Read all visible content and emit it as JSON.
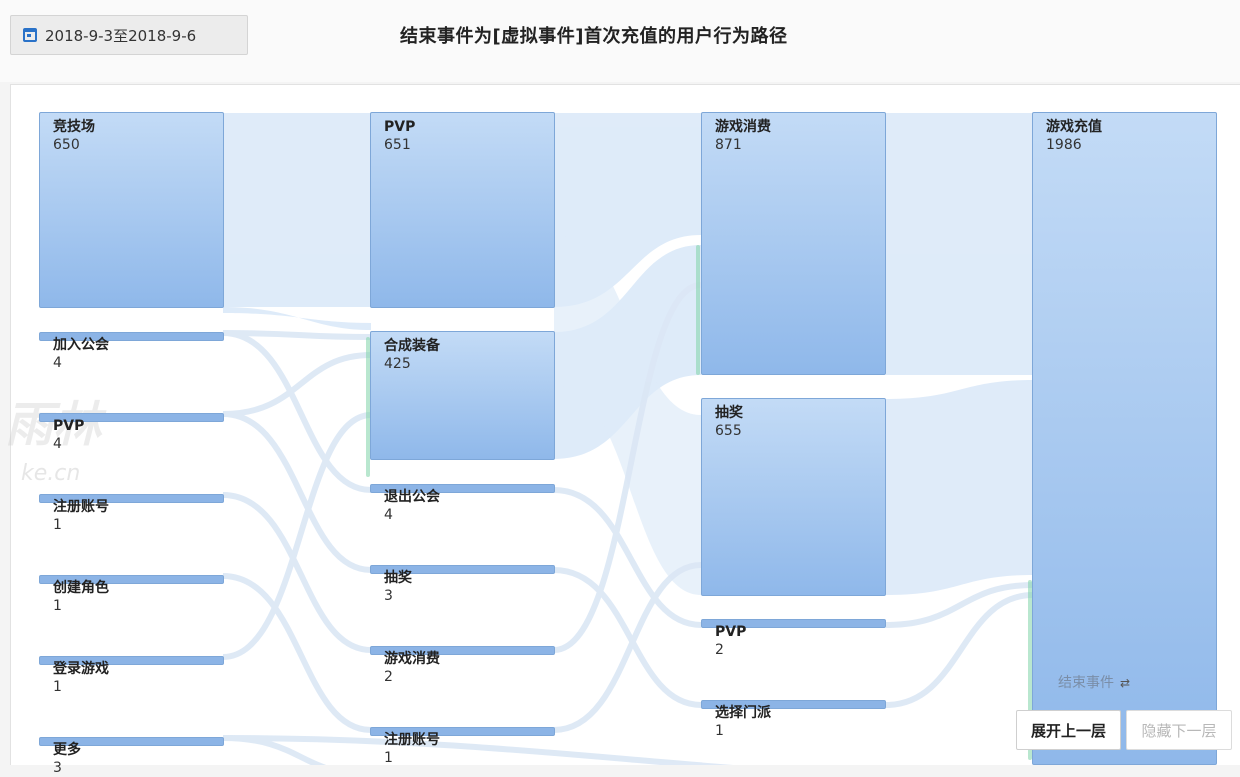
{
  "header": {
    "date_range": "2018-9-3至2018-9-6",
    "title": "结束事件为[虚拟事件]首次充值的用户行为路径"
  },
  "columns": [
    [
      {
        "name": "竞技场",
        "count": "650"
      },
      {
        "name": "加入公会",
        "count": "4"
      },
      {
        "name": "PVP",
        "count": "4"
      },
      {
        "name": "注册账号",
        "count": "1"
      },
      {
        "name": "创建角色",
        "count": "1"
      },
      {
        "name": "登录游戏",
        "count": "1"
      },
      {
        "name": "更多",
        "count": "3"
      }
    ],
    [
      {
        "name": "PVP",
        "count": "651"
      },
      {
        "name": "合成装备",
        "count": "425"
      },
      {
        "name": "退出公会",
        "count": "4"
      },
      {
        "name": "抽奖",
        "count": "3"
      },
      {
        "name": "游戏消费",
        "count": "2"
      },
      {
        "name": "注册账号",
        "count": "1"
      }
    ],
    [
      {
        "name": "游戏消费",
        "count": "871"
      },
      {
        "name": "抽奖",
        "count": "655"
      },
      {
        "name": "PVP",
        "count": "2"
      },
      {
        "name": "选择门派",
        "count": "1"
      }
    ],
    [
      {
        "name": "游戏充值",
        "count": "1986"
      }
    ]
  ],
  "end_event_label": "结束事件",
  "end_event_icon": "swap-arrows-icon",
  "buttons": {
    "expand_up": "展开上一层",
    "hide_down": "隐藏下一层"
  },
  "watermark": {
    "main": "雨林",
    "sub": "ke.cn"
  },
  "colors": {
    "node_top": "#c3dbf6",
    "node_bottom": "#8fb8ea",
    "flow": "#d9e8f8",
    "flow_green": "#7fd3a8"
  }
}
